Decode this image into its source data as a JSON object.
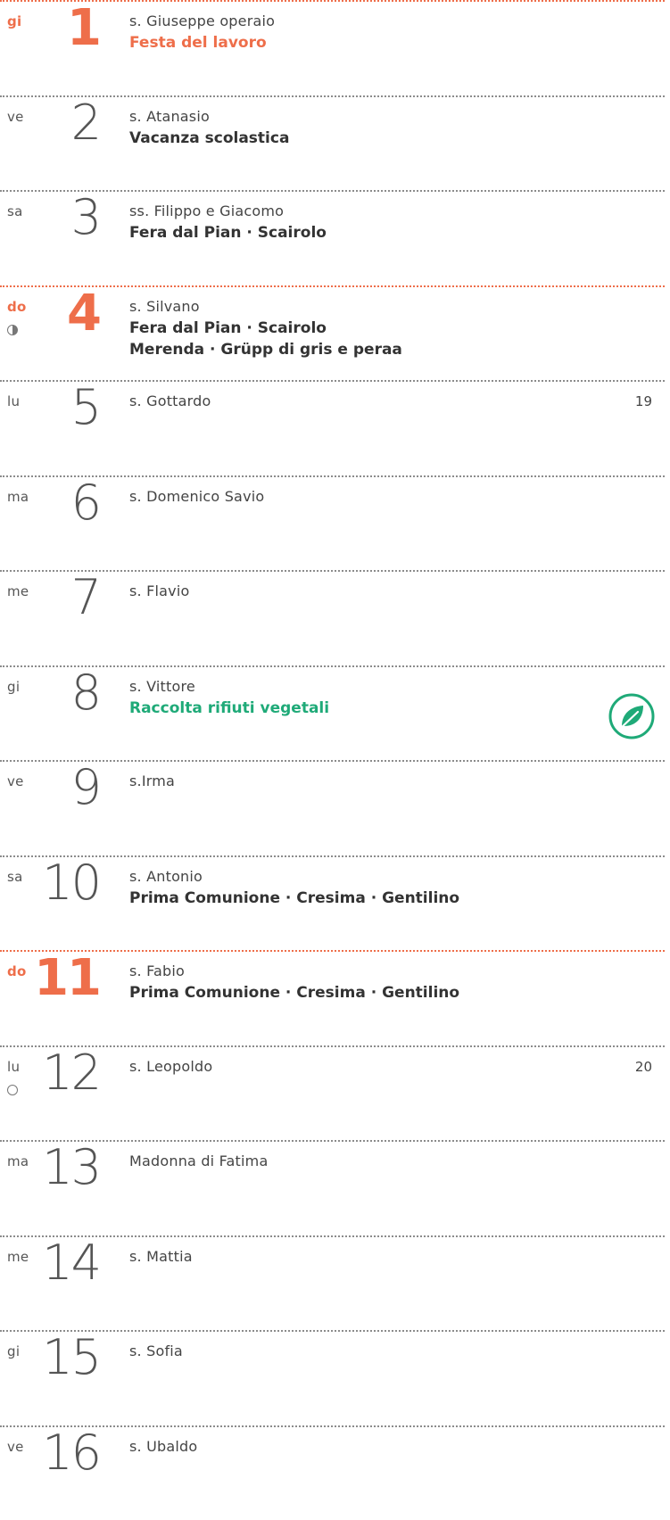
{
  "days": [
    {
      "dow": "gi",
      "num": "1",
      "saint": "s. Giuseppe operaio",
      "events": [
        {
          "text": "Festa del lavoro",
          "color": "red"
        }
      ],
      "holiday": true
    },
    {
      "dow": "ve",
      "num": "2",
      "saint": "s. Atanasio",
      "events": [
        {
          "text": "Vacanza scolastica",
          "color": "dark"
        }
      ]
    },
    {
      "dow": "sa",
      "num": "3",
      "saint": "ss. Filippo e Giacomo",
      "events": [
        {
          "text": "Fera dal Pian · Scairolo",
          "color": "dark"
        }
      ]
    },
    {
      "dow": "do",
      "num": "4",
      "saint": "s. Silvano",
      "events": [
        {
          "text": "Fera dal Pian · Scairolo",
          "color": "dark"
        },
        {
          "text": "Merenda · Grüpp di gris e peraa",
          "color": "dark"
        }
      ],
      "holiday": true,
      "moon": "half"
    },
    {
      "dow": "lu",
      "num": "5",
      "saint": "s. Gottardo",
      "week": "19"
    },
    {
      "dow": "ma",
      "num": "6",
      "saint": "s. Domenico Savio"
    },
    {
      "dow": "me",
      "num": "7",
      "saint": "s. Flavio"
    },
    {
      "dow": "gi",
      "num": "8",
      "saint": "s. Vittore",
      "events": [
        {
          "text": "Raccolta rifiuti vegetali",
          "color": "green"
        }
      ],
      "icon": "leaf-icon"
    },
    {
      "dow": "ve",
      "num": "9",
      "saint": "s.Irma"
    },
    {
      "dow": "sa",
      "num": "10",
      "saint": "s. Antonio",
      "events": [
        {
          "text": "Prima Comunione · Cresima · Gentilino",
          "color": "dark"
        }
      ]
    },
    {
      "dow": "do",
      "num": "11",
      "saint": "s. Fabio",
      "events": [
        {
          "text": "Prima Comunione · Cresima · Gentilino",
          "color": "dark"
        }
      ],
      "holiday": true
    },
    {
      "dow": "lu",
      "num": "12",
      "saint": "s. Leopoldo",
      "week": "20",
      "moon": "full"
    },
    {
      "dow": "ma",
      "num": "13",
      "saint": "Madonna di Fatima"
    },
    {
      "dow": "me",
      "num": "14",
      "saint": "s. Mattia"
    },
    {
      "dow": "gi",
      "num": "15",
      "saint": "s. Sofia"
    },
    {
      "dow": "ve",
      "num": "16",
      "saint": "s. Ubaldo"
    }
  ],
  "colors": {
    "holiday": "#ee6e4a",
    "green": "#1faa78",
    "text": "#333333"
  }
}
